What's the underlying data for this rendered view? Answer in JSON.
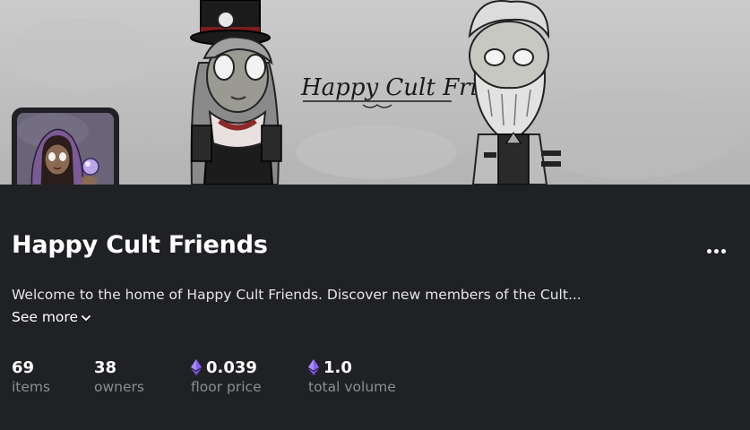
{
  "banner": {
    "logo_text": "Happy Cult Friends"
  },
  "collection": {
    "name": "Happy Cult Friends",
    "description": "Welcome to the home of Happy Cult Friends. Discover new members of the Cult...",
    "see_more_label": "See more"
  },
  "stats": [
    {
      "value": "69",
      "label": "items",
      "icon": null
    },
    {
      "value": "38",
      "label": "owners",
      "icon": null
    },
    {
      "value": "0.039",
      "label": "floor price",
      "icon": "ethereum-icon"
    },
    {
      "value": "1.0",
      "label": "total volume",
      "icon": "ethereum-icon"
    }
  ],
  "colors": {
    "background": "#202124",
    "muted_text": "#8a8d93",
    "eth_purple": "#8a5cf6"
  }
}
